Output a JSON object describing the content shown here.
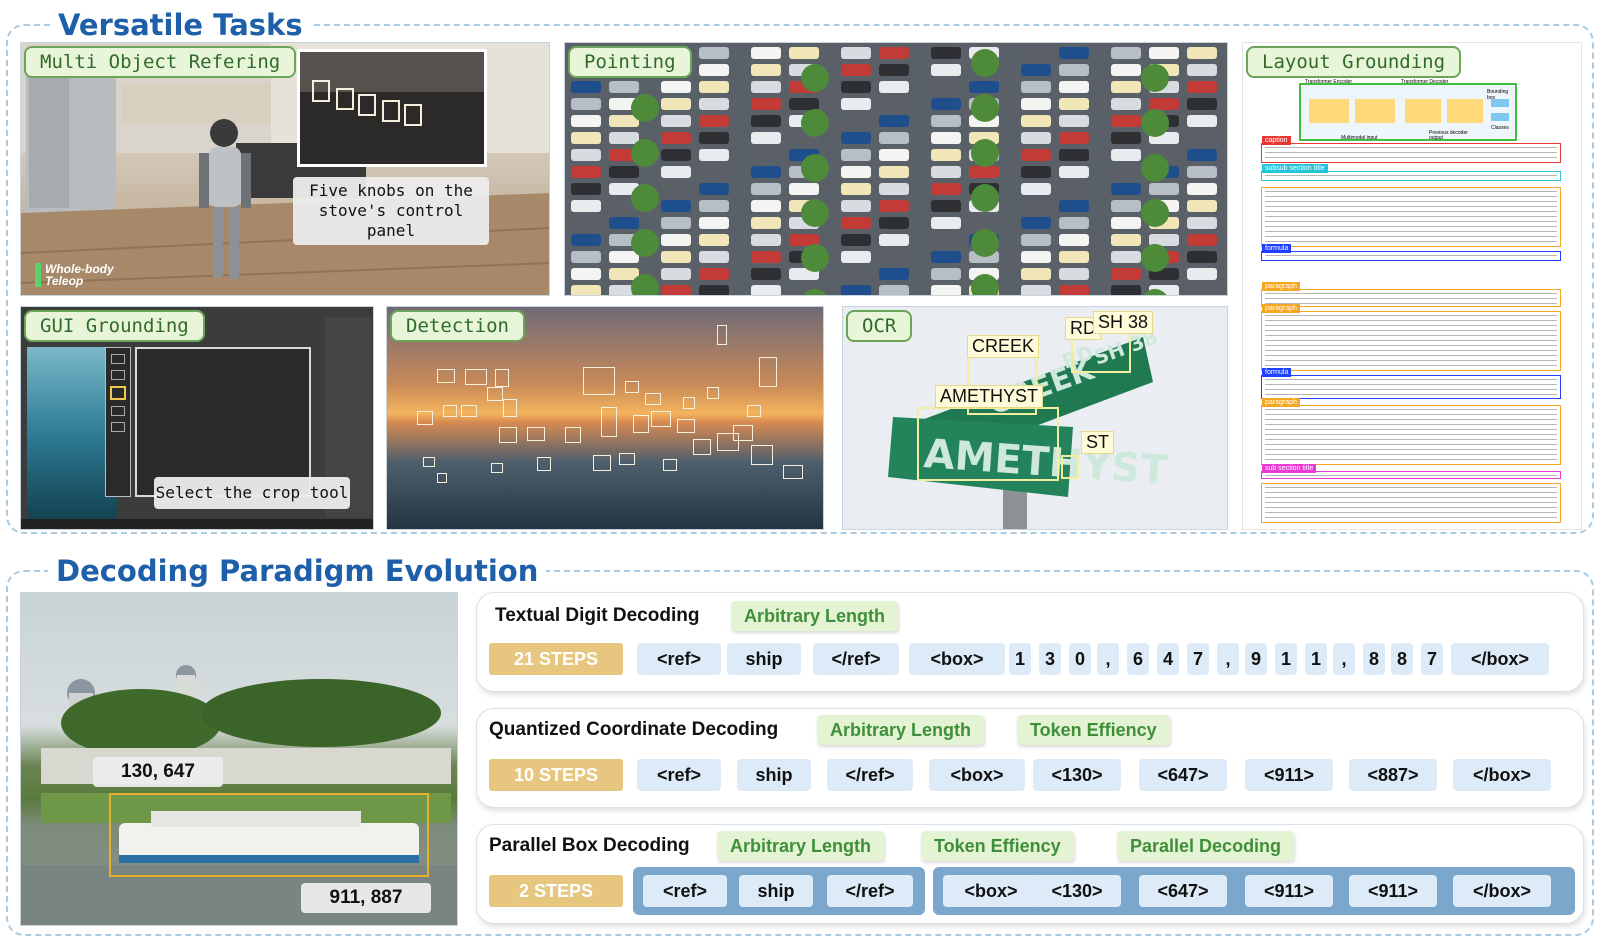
{
  "sections": {
    "top_title": "Versatile Tasks",
    "bottom_title": "Decoding Paradigm Evolution"
  },
  "panels": {
    "multi_object": {
      "tag": "Multi Object Refering",
      "caption": "Five knobs on the stove's control panel",
      "watermark": "Whole-body Teleop"
    },
    "pointing": {
      "tag": "Pointing"
    },
    "layout": {
      "tag": "Layout Grounding",
      "labels": {
        "caption": "caption",
        "subsub": "subsub section title",
        "paragraph": "paragraph",
        "formula": "formula",
        "sub_section": "sub section title"
      },
      "diagram_labels": {
        "encoder": "Transformer Encoder",
        "decoder": "Transformer Decoder",
        "bbox": "Bounding box",
        "classes": "Classes",
        "mm_input": "Multimodal input",
        "prev": "Previous decoder output"
      }
    },
    "gui": {
      "tag": "GUI Grounding",
      "caption": "Select the crop tool"
    },
    "detection": {
      "tag": "Detection"
    },
    "ocr": {
      "tag": "OCR",
      "labels": [
        "CREEK",
        "RD",
        "SH 38",
        "AMETHYST",
        "ST"
      ],
      "signs": {
        "creek": "CREEK",
        "amethyst": "AMETHYST",
        "rd": "RD",
        "sh": "SH 38"
      }
    }
  },
  "ship_panel": {
    "label_top": "130, 647",
    "label_bottom": "911, 887"
  },
  "rows": [
    {
      "title": "Textual Digit Decoding",
      "badges": [
        "Arbitrary Length"
      ],
      "steps": "21 STEPS",
      "tokens": [
        "<ref>",
        "ship",
        "</ref>",
        "<box>",
        "1",
        "3",
        "0",
        ",",
        "6",
        "4",
        "7",
        ",",
        "9",
        "1",
        "1",
        ",",
        "8",
        "8",
        "7",
        "</box>"
      ]
    },
    {
      "title": "Quantized Coordinate Decoding",
      "badges": [
        "Arbitrary Length",
        "Token Effiency"
      ],
      "steps": "10 STEPS",
      "tokens": [
        "<ref>",
        "ship",
        "</ref>",
        "<box>",
        "<130>",
        "<647>",
        "<911>",
        "<887>",
        "</box>"
      ]
    },
    {
      "title": "Parallel Box Decoding",
      "badges": [
        "Arbitrary Length",
        "Token Effiency",
        "Parallel Decoding"
      ],
      "steps": "2 STEPS",
      "tokens": [
        "<ref>",
        "ship",
        "</ref>",
        "<box>",
        "<130>",
        "<647>",
        "<911>",
        "<911>",
        "</box>"
      ]
    }
  ],
  "colors": {
    "title_blue": "#1d5fa8",
    "tag_green": "#e8f5d8",
    "steps_gold": "#e7c77f",
    "token_blue": "#dcebf7",
    "group_blue": "#7ca7cc"
  }
}
